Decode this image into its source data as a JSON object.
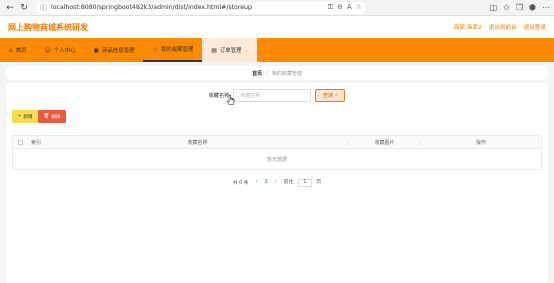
{
  "browser": {
    "url": "localhost:8080/springboot482k3/admin/dist/index.html#/storeup"
  },
  "header": {
    "title": "网上购物商城系统研发",
    "links": [
      "商家 商家2",
      "退出到前台",
      "退出登录"
    ]
  },
  "nav": {
    "items": [
      {
        "label": "首页",
        "icon": "home-icon",
        "glyph": "⌂"
      },
      {
        "label": "个人中心",
        "icon": "user-icon",
        "glyph": "👤"
      },
      {
        "label": "商品信息管理",
        "icon": "goods-icon",
        "glyph": "▣"
      },
      {
        "label": "我的收藏管理",
        "icon": "star-icon",
        "glyph": "☆"
      },
      {
        "label": "订单管理",
        "icon": "order-icon",
        "glyph": "▤"
      }
    ]
  },
  "breadcrumb": {
    "home": "首页",
    "separator": "/",
    "current": "我的收藏管理"
  },
  "search": {
    "label": "收藏名称",
    "placeholder": "收藏名称",
    "button": "查询"
  },
  "actions": {
    "add": "新增",
    "delete": "删除"
  },
  "table": {
    "columns": [
      "索引",
      "收藏名称",
      "收藏图片",
      "操作"
    ],
    "empty_text": "暂无数据"
  },
  "pagination": {
    "total": "共 0 条",
    "current_page": "1",
    "goto_prefix": "前往",
    "goto_value": "1",
    "goto_suffix": "页"
  },
  "colors": {
    "accent": "#ff8a00",
    "title": "#f07c00",
    "add_button": "#f7dd50",
    "delete_button": "#ea5a3f"
  }
}
